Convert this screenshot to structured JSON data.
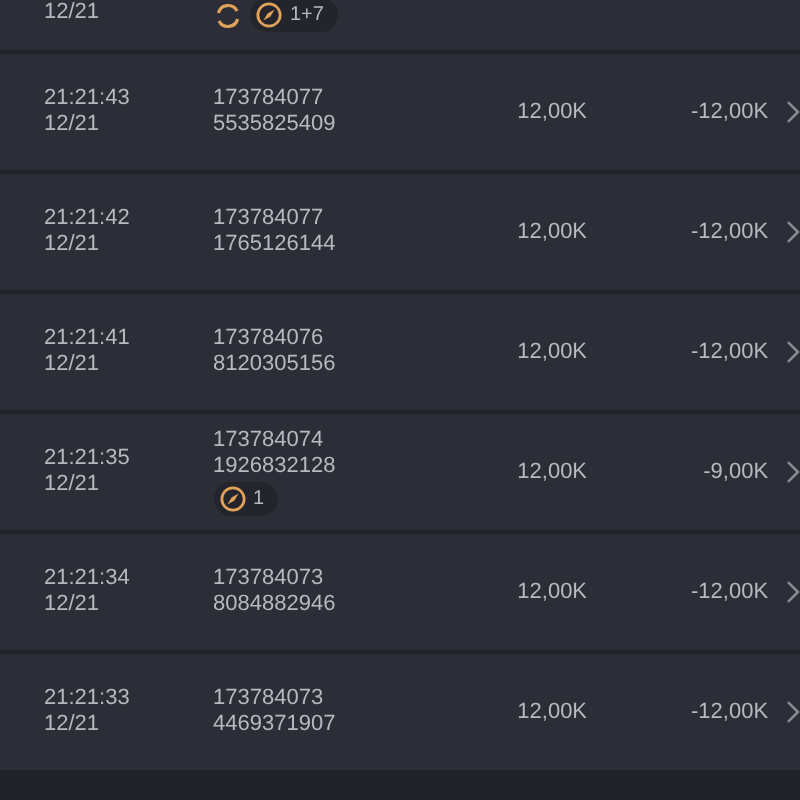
{
  "cut_row": {
    "date": "12/21",
    "badges": [
      {
        "kind": "refresh"
      },
      {
        "kind": "pill",
        "count": "1+7"
      }
    ]
  },
  "rows": [
    {
      "time": "21:21:43",
      "date": "12/21",
      "id": "173784077",
      "ticket": "5535825409",
      "amount": "12,00K",
      "net": "-12,00K",
      "badges": []
    },
    {
      "time": "21:21:42",
      "date": "12/21",
      "id": "173784077",
      "ticket": "1765126144",
      "amount": "12,00K",
      "net": "-12,00K",
      "badges": []
    },
    {
      "time": "21:21:41",
      "date": "12/21",
      "id": "173784076",
      "ticket": "8120305156",
      "amount": "12,00K",
      "net": "-12,00K",
      "badges": []
    },
    {
      "time": "21:21:35",
      "date": "12/21",
      "id": "173784074",
      "ticket": "1926832128",
      "amount": "12,00K",
      "net": "-9,00K",
      "badges": [
        {
          "kind": "pill",
          "count": "1"
        }
      ]
    },
    {
      "time": "21:21:34",
      "date": "12/21",
      "id": "173784073",
      "ticket": "8084882946",
      "amount": "12,00K",
      "net": "-12,00K",
      "badges": []
    },
    {
      "time": "21:21:33",
      "date": "12/21",
      "id": "173784073",
      "ticket": "4469371907",
      "amount": "12,00K",
      "net": "-12,00K",
      "badges": []
    }
  ]
}
